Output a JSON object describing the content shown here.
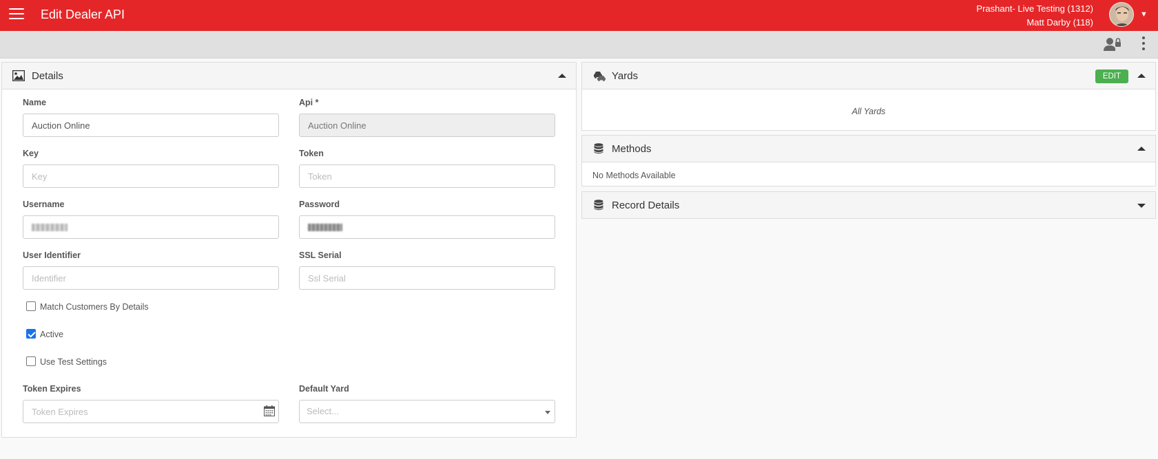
{
  "header": {
    "title": "Edit Dealer API",
    "user_line1": "Prashant- Live Testing (1312)",
    "user_line2": "Matt Darby (118)"
  },
  "details": {
    "title": "Details",
    "fields": {
      "name": {
        "label": "Name",
        "value": "Auction Online"
      },
      "api": {
        "label": "Api *",
        "value": "Auction Online"
      },
      "key": {
        "label": "Key",
        "placeholder": "Key",
        "value": ""
      },
      "token": {
        "label": "Token",
        "placeholder": "Token",
        "value": ""
      },
      "username": {
        "label": "Username"
      },
      "password": {
        "label": "Password"
      },
      "user_identifier": {
        "label": "User Identifier",
        "placeholder": "Identifier",
        "value": ""
      },
      "ssl_serial": {
        "label": "SSL Serial",
        "placeholder": "Ssl Serial",
        "value": ""
      },
      "token_expires": {
        "label": "Token Expires",
        "placeholder": "Token Expires",
        "value": ""
      },
      "default_yard": {
        "label": "Default Yard",
        "placeholder": "Select..."
      }
    },
    "checkboxes": {
      "match_customers": {
        "label": "Match Customers By Details",
        "checked": false
      },
      "active": {
        "label": "Active",
        "checked": true
      },
      "use_test": {
        "label": "Use Test Settings",
        "checked": false
      }
    }
  },
  "yards": {
    "title": "Yards",
    "edit_label": "EDIT",
    "content": "All Yards"
  },
  "methods": {
    "title": "Methods",
    "content": "No Methods Available"
  },
  "record_details": {
    "title": "Record Details"
  },
  "colors": {
    "header_bg": "#e52628",
    "edit_button": "#4caf50",
    "checkbox_checked": "#1a73e8"
  },
  "icons": {
    "menu": "hamburger-menu-icon",
    "details": "image-icon",
    "yards": "cars-icon",
    "methods": "database-icon",
    "record_details": "database-icon",
    "toolbar_user": "user-lock-icon",
    "toolbar_more": "more-vertical-icon",
    "calendar": "calendar-icon"
  }
}
